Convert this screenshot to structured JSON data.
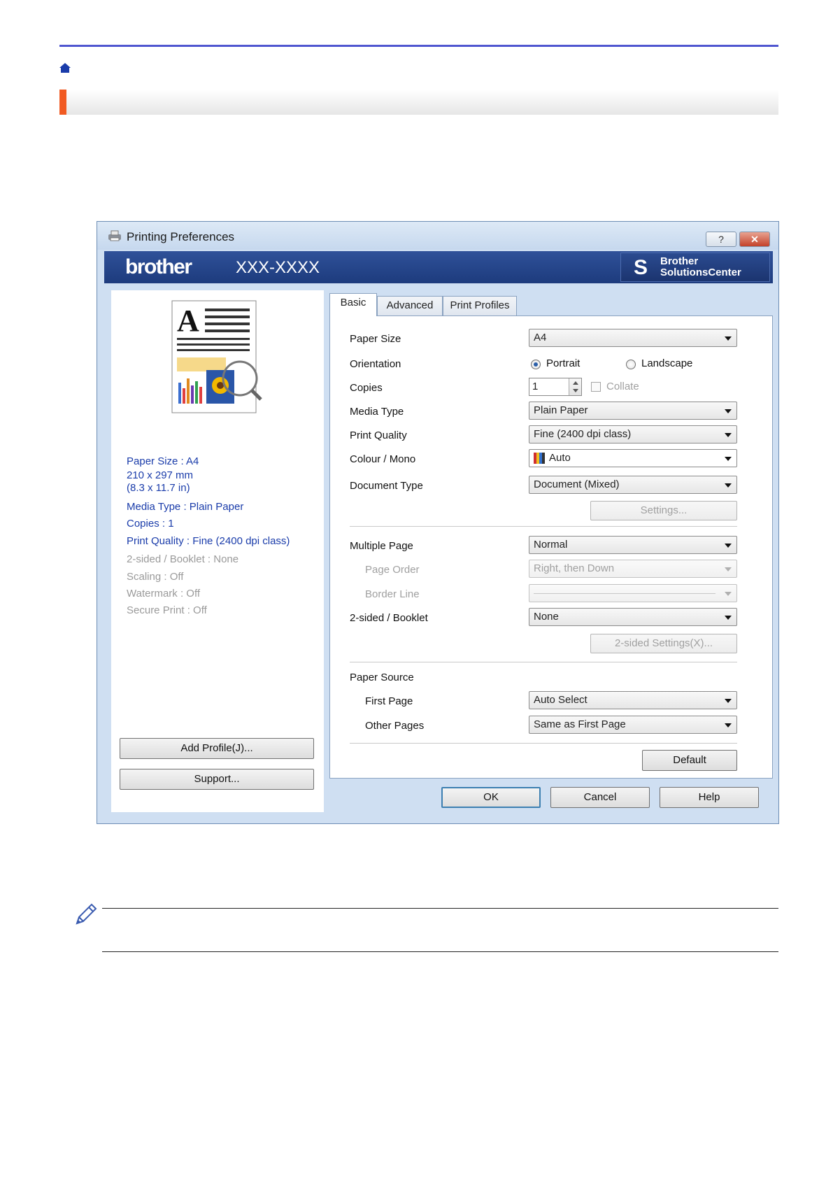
{
  "colors": {
    "top_rule": "#4f56d0",
    "header_accent": "#f15a22",
    "banner": "#2f5199",
    "summary_blue": "#1a3caa"
  },
  "window": {
    "title": "Printing Preferences",
    "help_btn": "?",
    "close_btn": "✕",
    "brand_logo": "brother",
    "model": "XXX-XXXX",
    "solutions_center_line1": "Brother",
    "solutions_center_line2": "SolutionsCenter"
  },
  "summary": {
    "paper_size": "Paper Size : A4",
    "paper_dims_mm": "210 x 297 mm",
    "paper_dims_in": "(8.3 x 11.7 in)",
    "media_type": "Media Type : Plain Paper",
    "copies": "Copies : 1",
    "print_quality": "Print Quality : Fine (2400 dpi class)",
    "two_sided": "2-sided / Booklet : None",
    "scaling": "Scaling : Off",
    "watermark": "Watermark : Off",
    "secure_print": "Secure Print : Off"
  },
  "left_buttons": {
    "add_profile": "Add Profile(J)...",
    "support": "Support..."
  },
  "tabs": [
    "Basic",
    "Advanced",
    "Print Profiles"
  ],
  "form": {
    "paper_size_label": "Paper Size",
    "paper_size_value": "A4",
    "orientation_label": "Orientation",
    "portrait": "Portrait",
    "landscape": "Landscape",
    "copies_label": "Copies",
    "copies_value": "1",
    "collate": "Collate",
    "media_type_label": "Media Type",
    "media_type_value": "Plain Paper",
    "print_quality_label": "Print Quality",
    "print_quality_value": "Fine (2400 dpi class)",
    "colour_mono_label": "Colour / Mono",
    "colour_mono_value": "Auto",
    "document_type_label": "Document Type",
    "document_type_value": "Document (Mixed)",
    "settings_btn": "Settings...",
    "multiple_page_label": "Multiple Page",
    "multiple_page_value": "Normal",
    "page_order_label": "Page Order",
    "page_order_value": "Right, then Down",
    "border_line_label": "Border Line",
    "two_sided_label": "2-sided / Booklet",
    "two_sided_value": "None",
    "two_sided_settings_btn": "2-sided Settings(X)...",
    "paper_source_label": "Paper Source",
    "first_page_label": "First Page",
    "first_page_value": "Auto Select",
    "other_pages_label": "Other Pages",
    "other_pages_value": "Same as First Page",
    "default_btn": "Default"
  },
  "footer_buttons": {
    "ok": "OK",
    "cancel": "Cancel",
    "help": "Help"
  }
}
